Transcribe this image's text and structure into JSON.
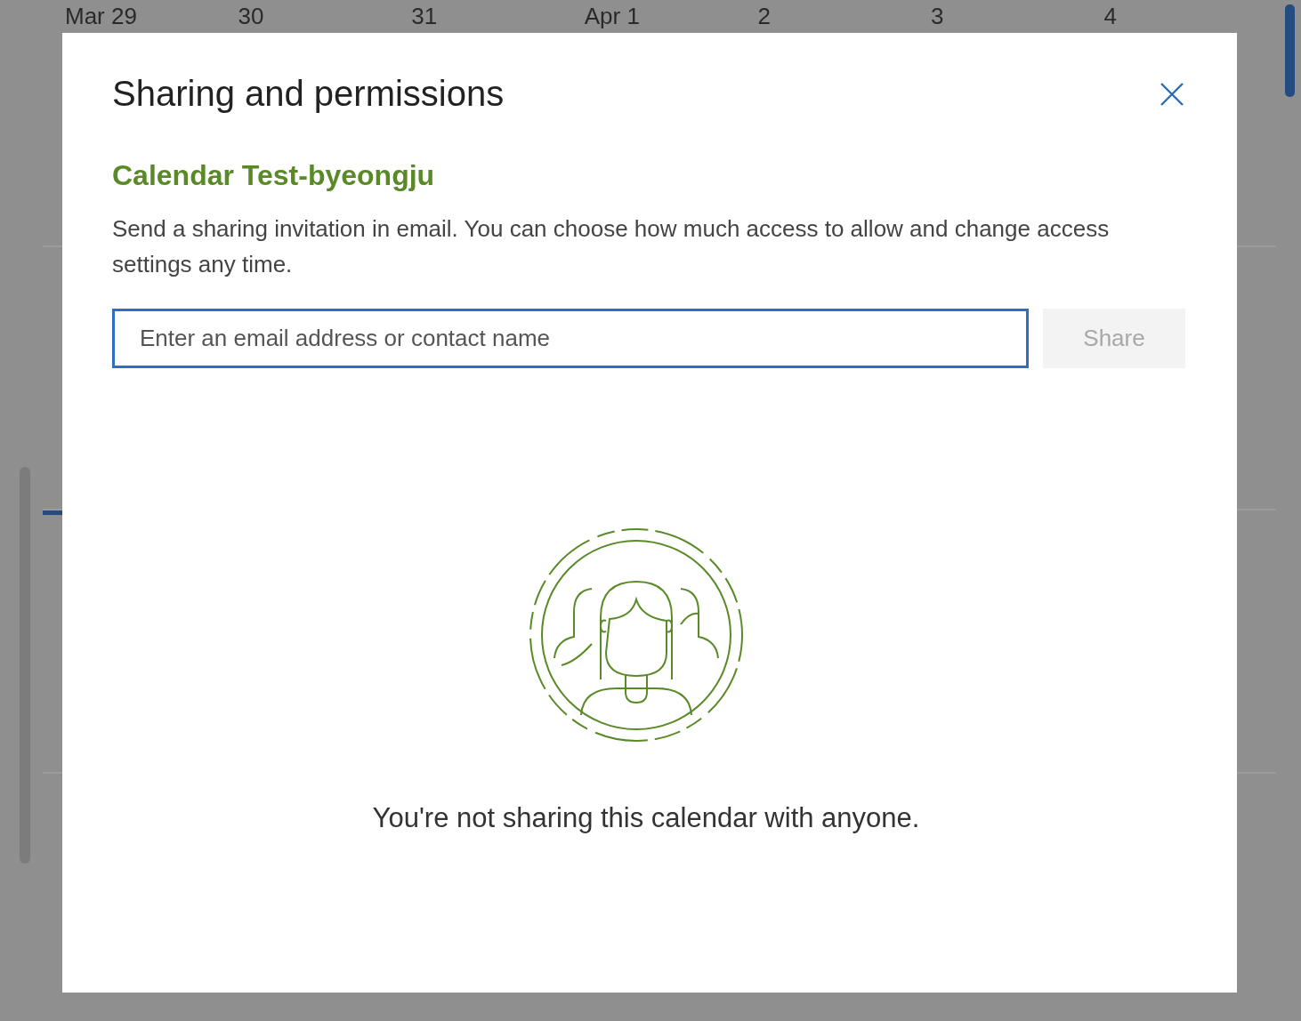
{
  "calendar_background": {
    "day_headers": [
      "Mar 29",
      "30",
      "31",
      "Apr 1",
      "2",
      "3",
      "4"
    ]
  },
  "dialog": {
    "title": "Sharing and permissions",
    "calendar_name": "Calendar Test-byeongju",
    "description": "Send a sharing invitation in email. You can choose how much access to allow and change access settings any time.",
    "email_field": {
      "placeholder": "Enter an email address or contact name"
    },
    "share_button": {
      "label": "Share",
      "disabled": true
    },
    "empty_message": "You're not sharing this calendar with anyone."
  }
}
